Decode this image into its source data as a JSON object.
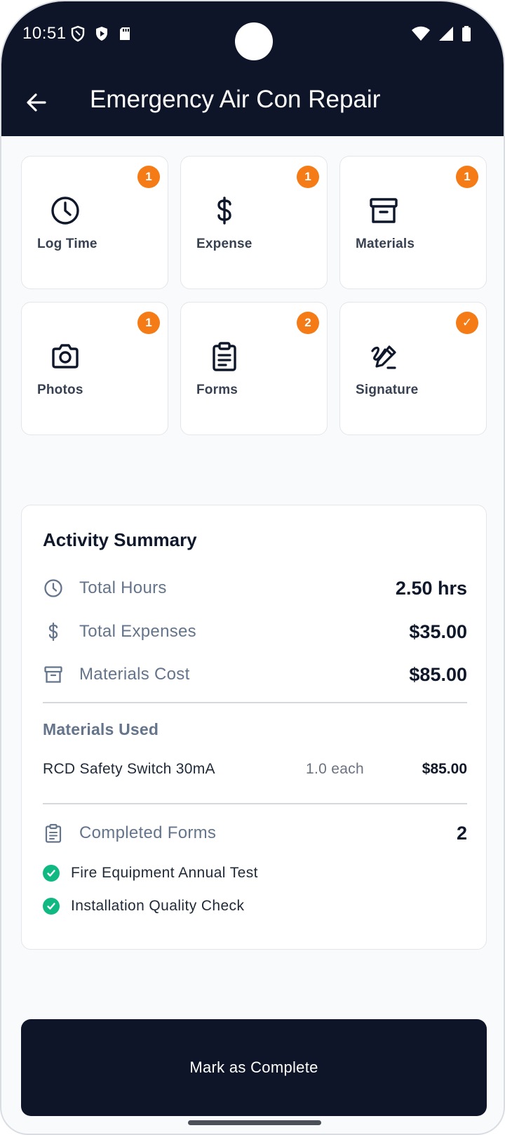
{
  "status_bar": {
    "time": "10:51"
  },
  "header": {
    "title": "Emergency Air Con Repair"
  },
  "tiles": [
    {
      "label": "Log Time",
      "badge": "1",
      "icon": "clock-icon"
    },
    {
      "label": "Expense",
      "badge": "1",
      "icon": "dollar-icon"
    },
    {
      "label": "Materials",
      "badge": "1",
      "icon": "archive-box-icon"
    },
    {
      "label": "Photos",
      "badge": "1",
      "icon": "camera-icon"
    },
    {
      "label": "Forms",
      "badge": "2",
      "icon": "clipboard-icon"
    },
    {
      "label": "Signature",
      "badge": "✓",
      "icon": "signature-pen-icon"
    }
  ],
  "summary": {
    "title": "Activity Summary",
    "total_hours_label": "Total Hours",
    "total_hours_value": "2.50 hrs",
    "total_expenses_label": "Total Expenses",
    "total_expenses_value": "$35.00",
    "materials_cost_label": "Materials Cost",
    "materials_cost_value": "$85.00",
    "materials_used_label": "Materials Used",
    "materials": [
      {
        "name": "RCD Safety Switch 30mA",
        "qty": "1.0 each",
        "price": "$85.00"
      }
    ],
    "completed_forms_label": "Completed Forms",
    "completed_forms_count": "2",
    "forms": [
      {
        "name": "Fire Equipment Annual Test"
      },
      {
        "name": "Installation Quality Check"
      }
    ]
  },
  "actions": {
    "complete_label": "Mark as Complete"
  },
  "colors": {
    "navy": "#0e1528",
    "badge_orange": "#f47b16",
    "check_green": "#10b981"
  }
}
